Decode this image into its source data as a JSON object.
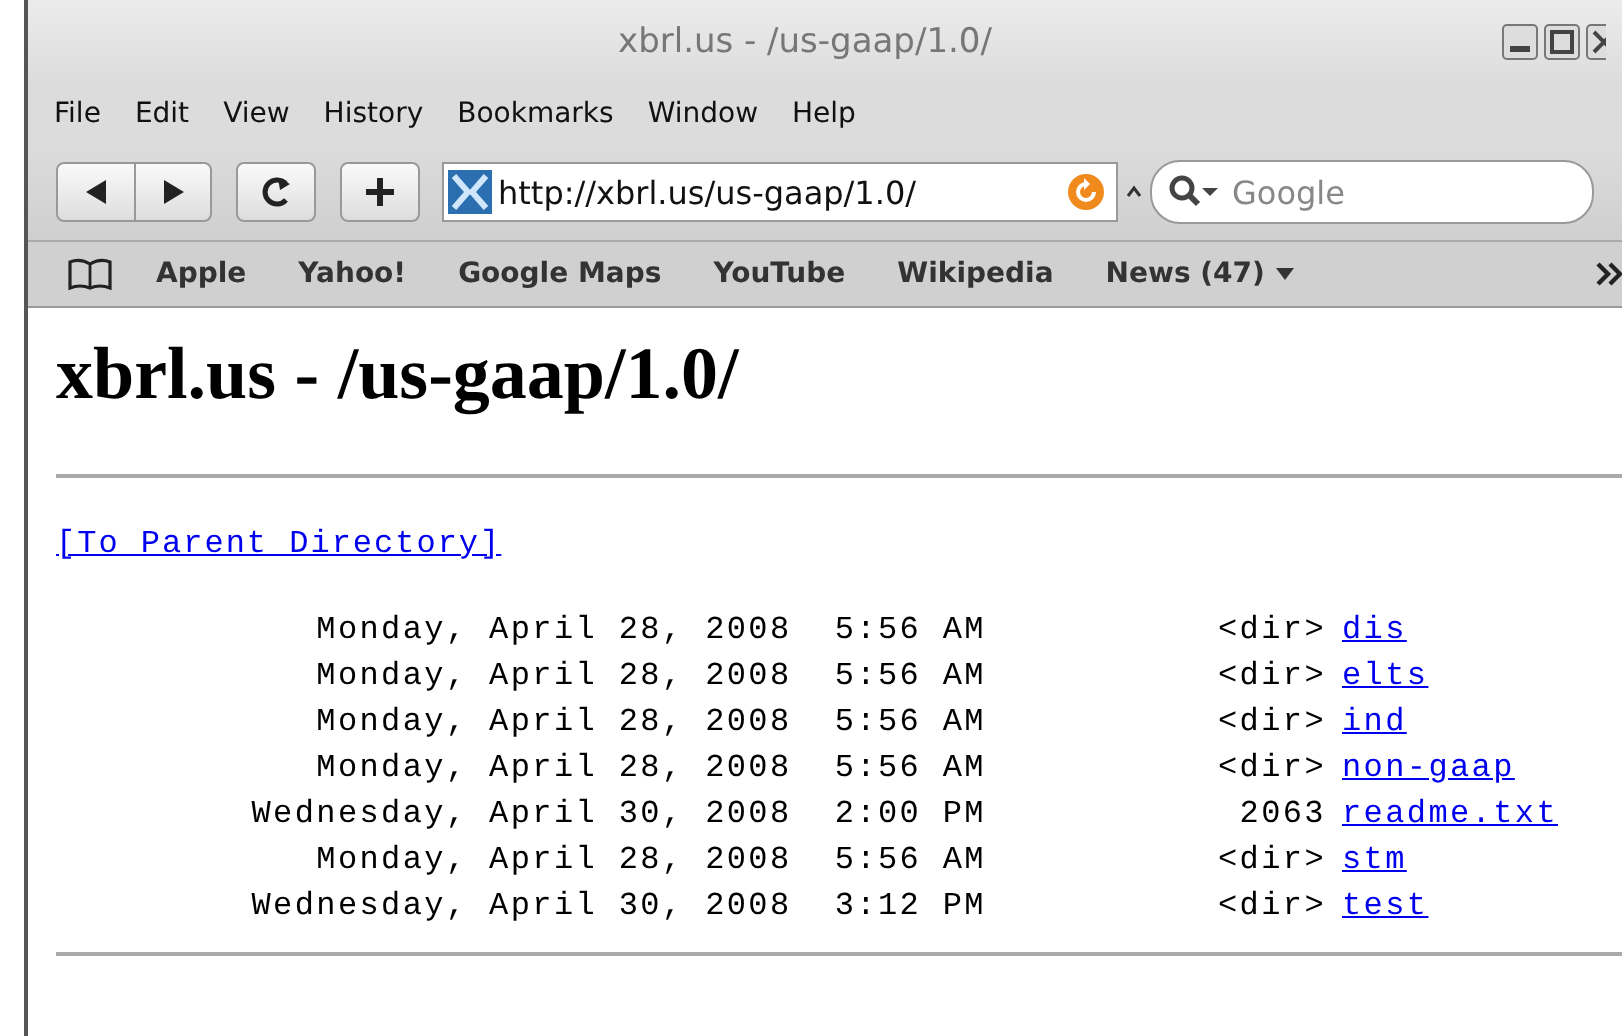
{
  "window": {
    "title": "xbrl.us - /us-gaap/1.0/"
  },
  "menu": [
    "File",
    "Edit",
    "View",
    "History",
    "Bookmarks",
    "Window",
    "Help"
  ],
  "toolbar": {
    "url": "http://xbrl.us/us-gaap/1.0/",
    "search": {
      "placeholder": "Google"
    }
  },
  "bookmarks": [
    {
      "label": "Apple",
      "kind": "link"
    },
    {
      "label": "Yahoo!",
      "kind": "link"
    },
    {
      "label": "Google Maps",
      "kind": "link"
    },
    {
      "label": "YouTube",
      "kind": "link"
    },
    {
      "label": "Wikipedia",
      "kind": "link"
    },
    {
      "label": "News (47)",
      "kind": "menu"
    }
  ],
  "page": {
    "heading": "xbrl.us - /us-gaap/1.0/",
    "parent_link": "[To Parent Directory]",
    "entries": [
      {
        "date": "Monday, April 28, 2008  5:56 AM",
        "size": "<dir>",
        "name": "dis"
      },
      {
        "date": "Monday, April 28, 2008  5:56 AM",
        "size": "<dir>",
        "name": "elts"
      },
      {
        "date": "Monday, April 28, 2008  5:56 AM",
        "size": "<dir>",
        "name": "ind"
      },
      {
        "date": "Monday, April 28, 2008  5:56 AM",
        "size": "<dir>",
        "name": "non-gaap"
      },
      {
        "date": "Wednesday, April 30, 2008  2:00 PM",
        "size": "2063",
        "name": "readme.txt"
      },
      {
        "date": "Monday, April 28, 2008  5:56 AM",
        "size": "<dir>",
        "name": "stm"
      },
      {
        "date": "Wednesday, April 30, 2008  3:12 PM",
        "size": "<dir>",
        "name": "test"
      }
    ]
  }
}
